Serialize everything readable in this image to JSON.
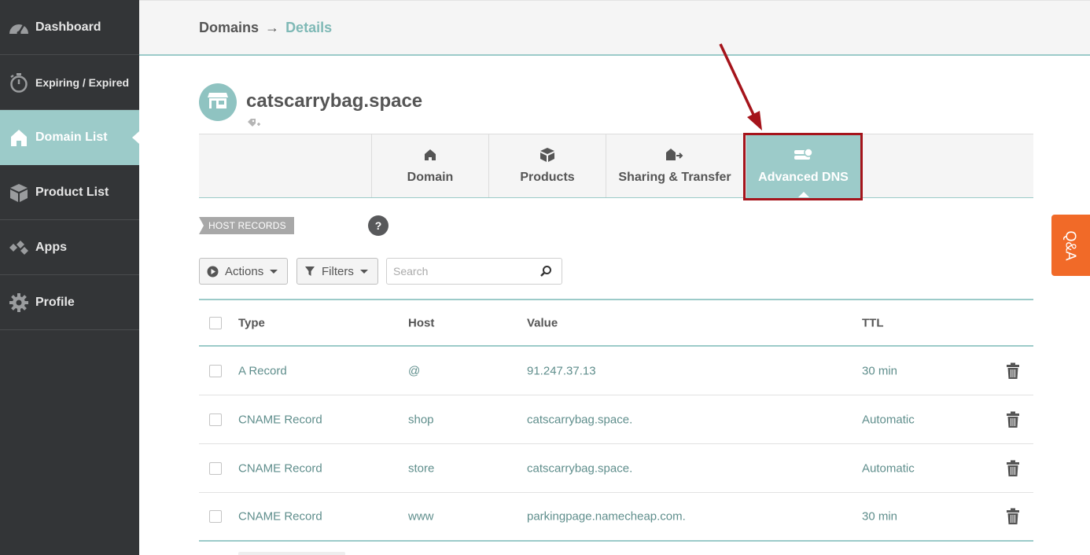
{
  "sidebar": {
    "items": [
      {
        "label": "Dashboard",
        "icon": "speedometer-icon"
      },
      {
        "label": "Expiring / Expired",
        "icon": "stopwatch-icon"
      },
      {
        "label": "Domain List",
        "icon": "home-icon",
        "active": true
      },
      {
        "label": "Product List",
        "icon": "box-icon"
      },
      {
        "label": "Apps",
        "icon": "apps-icon"
      },
      {
        "label": "Profile",
        "icon": "gear-icon"
      }
    ]
  },
  "header": {
    "breadcrumb_parent": "Domains",
    "breadcrumb_arrow": "→",
    "breadcrumb_current": "Details"
  },
  "domain": {
    "name": "catscarrybag.space",
    "avatar_icon": "storefront-icon",
    "tag_icon": "add-tag-icon"
  },
  "tabs": [
    {
      "label": "Domain",
      "icon": "home-icon"
    },
    {
      "label": "Products",
      "icon": "box-icon"
    },
    {
      "label": "Sharing & Transfer",
      "icon": "share-house-icon"
    },
    {
      "label": "Advanced DNS",
      "icon": "dns-server-icon",
      "active": true
    }
  ],
  "section": {
    "host_records_label": "HOST RECORDS",
    "help_label": "?"
  },
  "controls": {
    "actions_label": "Actions",
    "filters_label": "Filters",
    "search_placeholder": "Search"
  },
  "table": {
    "headers": {
      "type": "Type",
      "host": "Host",
      "value": "Value",
      "ttl": "TTL"
    },
    "rows": [
      {
        "type": "A Record",
        "host": "@",
        "value": "91.247.37.13",
        "ttl": "30 min"
      },
      {
        "type": "CNAME Record",
        "host": "shop",
        "value": "catscarrybag.space.",
        "ttl": "Automatic"
      },
      {
        "type": "CNAME Record",
        "host": "store",
        "value": "catscarrybag.space.",
        "ttl": "Automatic"
      },
      {
        "type": "CNAME Record",
        "host": "www",
        "value": "parkingpage.namecheap.com.",
        "ttl": "30 min"
      }
    ]
  },
  "qa": {
    "label": "Q&A"
  },
  "colors": {
    "accent": "#9ccbc9",
    "sidebar_bg": "#333537",
    "highlight": "#a5141b",
    "qa_orange": "#f16a28"
  }
}
